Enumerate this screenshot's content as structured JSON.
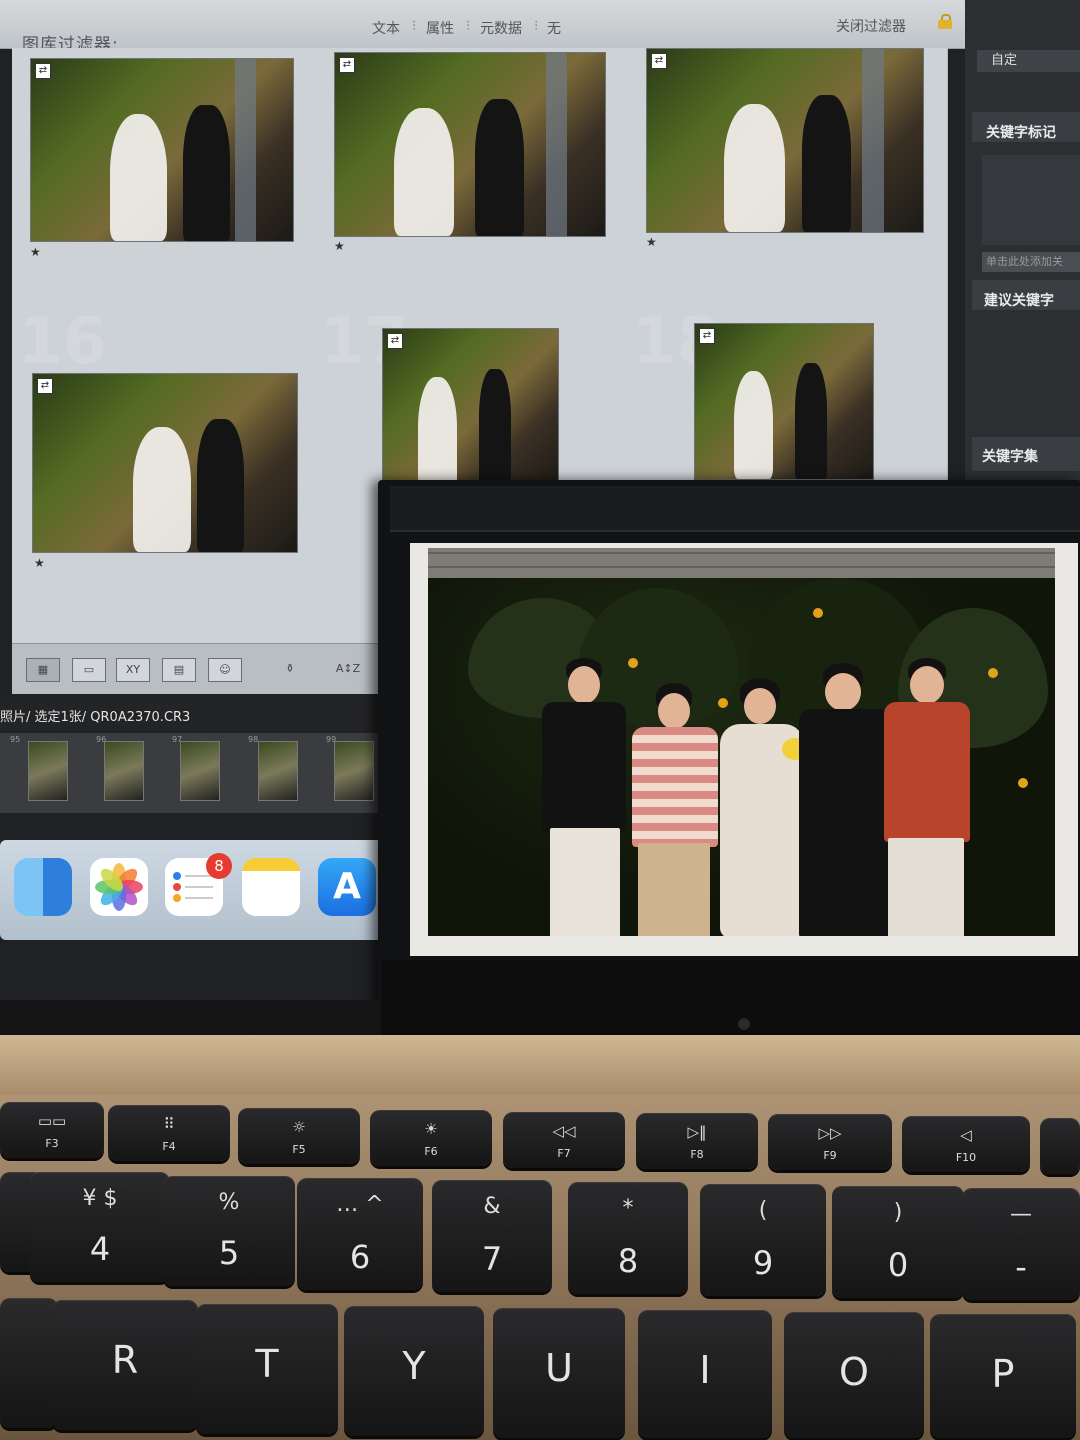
{
  "lightroom": {
    "panel_title": "图库过滤器:",
    "filter_tabs": [
      "文本",
      "属性",
      "元数据",
      "无"
    ],
    "close_filter": "关闭过滤器",
    "right_panel": {
      "preset": "自定",
      "keyword_tags": "关键字标记",
      "add_keyword_placeholder": "单击此处添加关",
      "suggested_keywords": "建议关键字",
      "keyword_set": "关键字集"
    },
    "grid": {
      "cell_numbers": [
        "16",
        "17",
        "18"
      ],
      "rating_star": "★"
    },
    "toolbar": {
      "sort_icon": "A↕Z"
    },
    "path_text": "照片/ 选定1张/ QR0A2370.CR3",
    "filmstrip_numbers": [
      "95",
      "96",
      "97",
      "98",
      "99"
    ]
  },
  "dock": {
    "apps": [
      "Finder",
      "Photos",
      "Reminders",
      "Notes",
      "App Store"
    ],
    "reminders_badge": "8"
  },
  "keyboard": {
    "function_keys": [
      {
        "symbol": "▭▭",
        "label": "F3"
      },
      {
        "symbol": "⠿",
        "label": "F4"
      },
      {
        "symbol": "☼",
        "label": "F5"
      },
      {
        "symbol": "☀",
        "label": "F6"
      },
      {
        "symbol": "◁◁",
        "label": "F7"
      },
      {
        "symbol": "▷‖",
        "label": "F8"
      },
      {
        "symbol": "▷▷",
        "label": "F9"
      },
      {
        "symbol": "◁",
        "label": "F10"
      }
    ],
    "number_keys": [
      {
        "top": "¥ $",
        "bottom": "4"
      },
      {
        "top": "%",
        "bottom": "5"
      },
      {
        "top": "… ^",
        "bottom": "6"
      },
      {
        "top": "&",
        "bottom": "7"
      },
      {
        "top": "*",
        "bottom": "8"
      },
      {
        "top": "(",
        "bottom": "9"
      },
      {
        "top": ")",
        "bottom": "0"
      },
      {
        "top": "—",
        "bottom": "-"
      }
    ],
    "letter_keys": [
      "R",
      "T",
      "Y",
      "U",
      "I",
      "O",
      "P"
    ]
  },
  "colors": {
    "lightroom_grid": "#c7ccd1",
    "badge_red": "#e63b30",
    "keyboard_key": "#1e1e20",
    "laptop_deck": "#a88c6b"
  }
}
